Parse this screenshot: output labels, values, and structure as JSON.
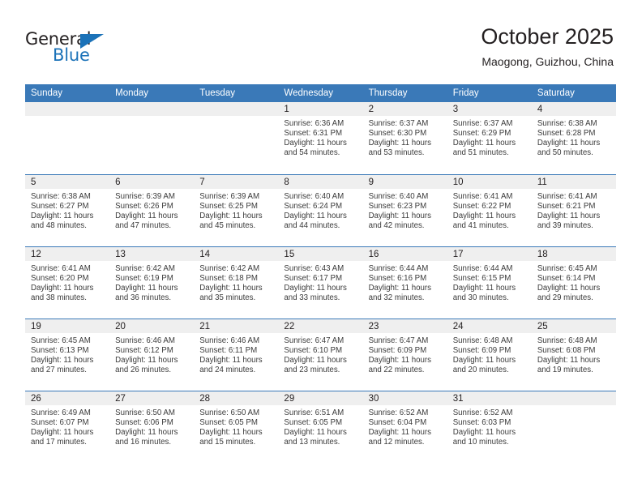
{
  "brand": {
    "name_part1": "General",
    "name_part2": "Blue",
    "accent_color": "#1b72b8"
  },
  "header": {
    "title": "October 2025",
    "subtitle": "Maogong, Guizhou, China"
  },
  "theme": {
    "header_blue": "#3a79b8",
    "daynum_gray": "#efefef"
  },
  "weekday_headers": [
    "Sunday",
    "Monday",
    "Tuesday",
    "Wednesday",
    "Thursday",
    "Friday",
    "Saturday"
  ],
  "weeks": [
    [
      {
        "day": "",
        "lines": []
      },
      {
        "day": "",
        "lines": []
      },
      {
        "day": "",
        "lines": []
      },
      {
        "day": "1",
        "lines": [
          "Sunrise: 6:36 AM",
          "Sunset: 6:31 PM",
          "Daylight: 11 hours",
          "and 54 minutes."
        ]
      },
      {
        "day": "2",
        "lines": [
          "Sunrise: 6:37 AM",
          "Sunset: 6:30 PM",
          "Daylight: 11 hours",
          "and 53 minutes."
        ]
      },
      {
        "day": "3",
        "lines": [
          "Sunrise: 6:37 AM",
          "Sunset: 6:29 PM",
          "Daylight: 11 hours",
          "and 51 minutes."
        ]
      },
      {
        "day": "4",
        "lines": [
          "Sunrise: 6:38 AM",
          "Sunset: 6:28 PM",
          "Daylight: 11 hours",
          "and 50 minutes."
        ]
      }
    ],
    [
      {
        "day": "5",
        "lines": [
          "Sunrise: 6:38 AM",
          "Sunset: 6:27 PM",
          "Daylight: 11 hours",
          "and 48 minutes."
        ]
      },
      {
        "day": "6",
        "lines": [
          "Sunrise: 6:39 AM",
          "Sunset: 6:26 PM",
          "Daylight: 11 hours",
          "and 47 minutes."
        ]
      },
      {
        "day": "7",
        "lines": [
          "Sunrise: 6:39 AM",
          "Sunset: 6:25 PM",
          "Daylight: 11 hours",
          "and 45 minutes."
        ]
      },
      {
        "day": "8",
        "lines": [
          "Sunrise: 6:40 AM",
          "Sunset: 6:24 PM",
          "Daylight: 11 hours",
          "and 44 minutes."
        ]
      },
      {
        "day": "9",
        "lines": [
          "Sunrise: 6:40 AM",
          "Sunset: 6:23 PM",
          "Daylight: 11 hours",
          "and 42 minutes."
        ]
      },
      {
        "day": "10",
        "lines": [
          "Sunrise: 6:41 AM",
          "Sunset: 6:22 PM",
          "Daylight: 11 hours",
          "and 41 minutes."
        ]
      },
      {
        "day": "11",
        "lines": [
          "Sunrise: 6:41 AM",
          "Sunset: 6:21 PM",
          "Daylight: 11 hours",
          "and 39 minutes."
        ]
      }
    ],
    [
      {
        "day": "12",
        "lines": [
          "Sunrise: 6:41 AM",
          "Sunset: 6:20 PM",
          "Daylight: 11 hours",
          "and 38 minutes."
        ]
      },
      {
        "day": "13",
        "lines": [
          "Sunrise: 6:42 AM",
          "Sunset: 6:19 PM",
          "Daylight: 11 hours",
          "and 36 minutes."
        ]
      },
      {
        "day": "14",
        "lines": [
          "Sunrise: 6:42 AM",
          "Sunset: 6:18 PM",
          "Daylight: 11 hours",
          "and 35 minutes."
        ]
      },
      {
        "day": "15",
        "lines": [
          "Sunrise: 6:43 AM",
          "Sunset: 6:17 PM",
          "Daylight: 11 hours",
          "and 33 minutes."
        ]
      },
      {
        "day": "16",
        "lines": [
          "Sunrise: 6:44 AM",
          "Sunset: 6:16 PM",
          "Daylight: 11 hours",
          "and 32 minutes."
        ]
      },
      {
        "day": "17",
        "lines": [
          "Sunrise: 6:44 AM",
          "Sunset: 6:15 PM",
          "Daylight: 11 hours",
          "and 30 minutes."
        ]
      },
      {
        "day": "18",
        "lines": [
          "Sunrise: 6:45 AM",
          "Sunset: 6:14 PM",
          "Daylight: 11 hours",
          "and 29 minutes."
        ]
      }
    ],
    [
      {
        "day": "19",
        "lines": [
          "Sunrise: 6:45 AM",
          "Sunset: 6:13 PM",
          "Daylight: 11 hours",
          "and 27 minutes."
        ]
      },
      {
        "day": "20",
        "lines": [
          "Sunrise: 6:46 AM",
          "Sunset: 6:12 PM",
          "Daylight: 11 hours",
          "and 26 minutes."
        ]
      },
      {
        "day": "21",
        "lines": [
          "Sunrise: 6:46 AM",
          "Sunset: 6:11 PM",
          "Daylight: 11 hours",
          "and 24 minutes."
        ]
      },
      {
        "day": "22",
        "lines": [
          "Sunrise: 6:47 AM",
          "Sunset: 6:10 PM",
          "Daylight: 11 hours",
          "and 23 minutes."
        ]
      },
      {
        "day": "23",
        "lines": [
          "Sunrise: 6:47 AM",
          "Sunset: 6:09 PM",
          "Daylight: 11 hours",
          "and 22 minutes."
        ]
      },
      {
        "day": "24",
        "lines": [
          "Sunrise: 6:48 AM",
          "Sunset: 6:09 PM",
          "Daylight: 11 hours",
          "and 20 minutes."
        ]
      },
      {
        "day": "25",
        "lines": [
          "Sunrise: 6:48 AM",
          "Sunset: 6:08 PM",
          "Daylight: 11 hours",
          "and 19 minutes."
        ]
      }
    ],
    [
      {
        "day": "26",
        "lines": [
          "Sunrise: 6:49 AM",
          "Sunset: 6:07 PM",
          "Daylight: 11 hours",
          "and 17 minutes."
        ]
      },
      {
        "day": "27",
        "lines": [
          "Sunrise: 6:50 AM",
          "Sunset: 6:06 PM",
          "Daylight: 11 hours",
          "and 16 minutes."
        ]
      },
      {
        "day": "28",
        "lines": [
          "Sunrise: 6:50 AM",
          "Sunset: 6:05 PM",
          "Daylight: 11 hours",
          "and 15 minutes."
        ]
      },
      {
        "day": "29",
        "lines": [
          "Sunrise: 6:51 AM",
          "Sunset: 6:05 PM",
          "Daylight: 11 hours",
          "and 13 minutes."
        ]
      },
      {
        "day": "30",
        "lines": [
          "Sunrise: 6:52 AM",
          "Sunset: 6:04 PM",
          "Daylight: 11 hours",
          "and 12 minutes."
        ]
      },
      {
        "day": "31",
        "lines": [
          "Sunrise: 6:52 AM",
          "Sunset: 6:03 PM",
          "Daylight: 11 hours",
          "and 10 minutes."
        ]
      },
      {
        "day": "",
        "lines": []
      }
    ]
  ]
}
